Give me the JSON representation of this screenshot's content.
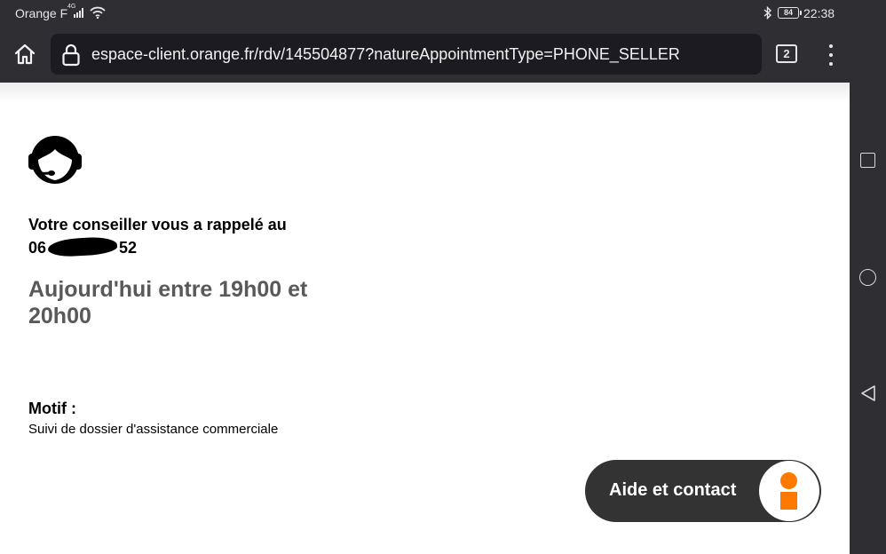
{
  "status_bar": {
    "carrier": "Orange F",
    "network_type": "4G",
    "battery": "84",
    "time": "22:38"
  },
  "browser": {
    "url": "espace-client.orange.fr/rdv/145504877?natureAppointmentType=PHONE_SELLER",
    "tab_count": "2"
  },
  "page": {
    "called_text": "Votre conseiller vous a rappelé au",
    "phone_prefix": "06",
    "phone_suffix": "52",
    "time_slot": "Aujourd'hui entre 19h00 et 20h00",
    "motif_label": "Motif :",
    "motif_value": "Suivi de dossier d'assistance commerciale"
  },
  "help_button": {
    "label": "Aide et contact"
  },
  "colors": {
    "brand_orange": "#ff7900",
    "chrome_dark": "#2e2e33",
    "help_button_bg": "#333333"
  },
  "icons": {
    "home": "home-icon",
    "lock": "lock-icon",
    "advisor": "headset-advisor-icon",
    "help": "orange-info-icon"
  }
}
